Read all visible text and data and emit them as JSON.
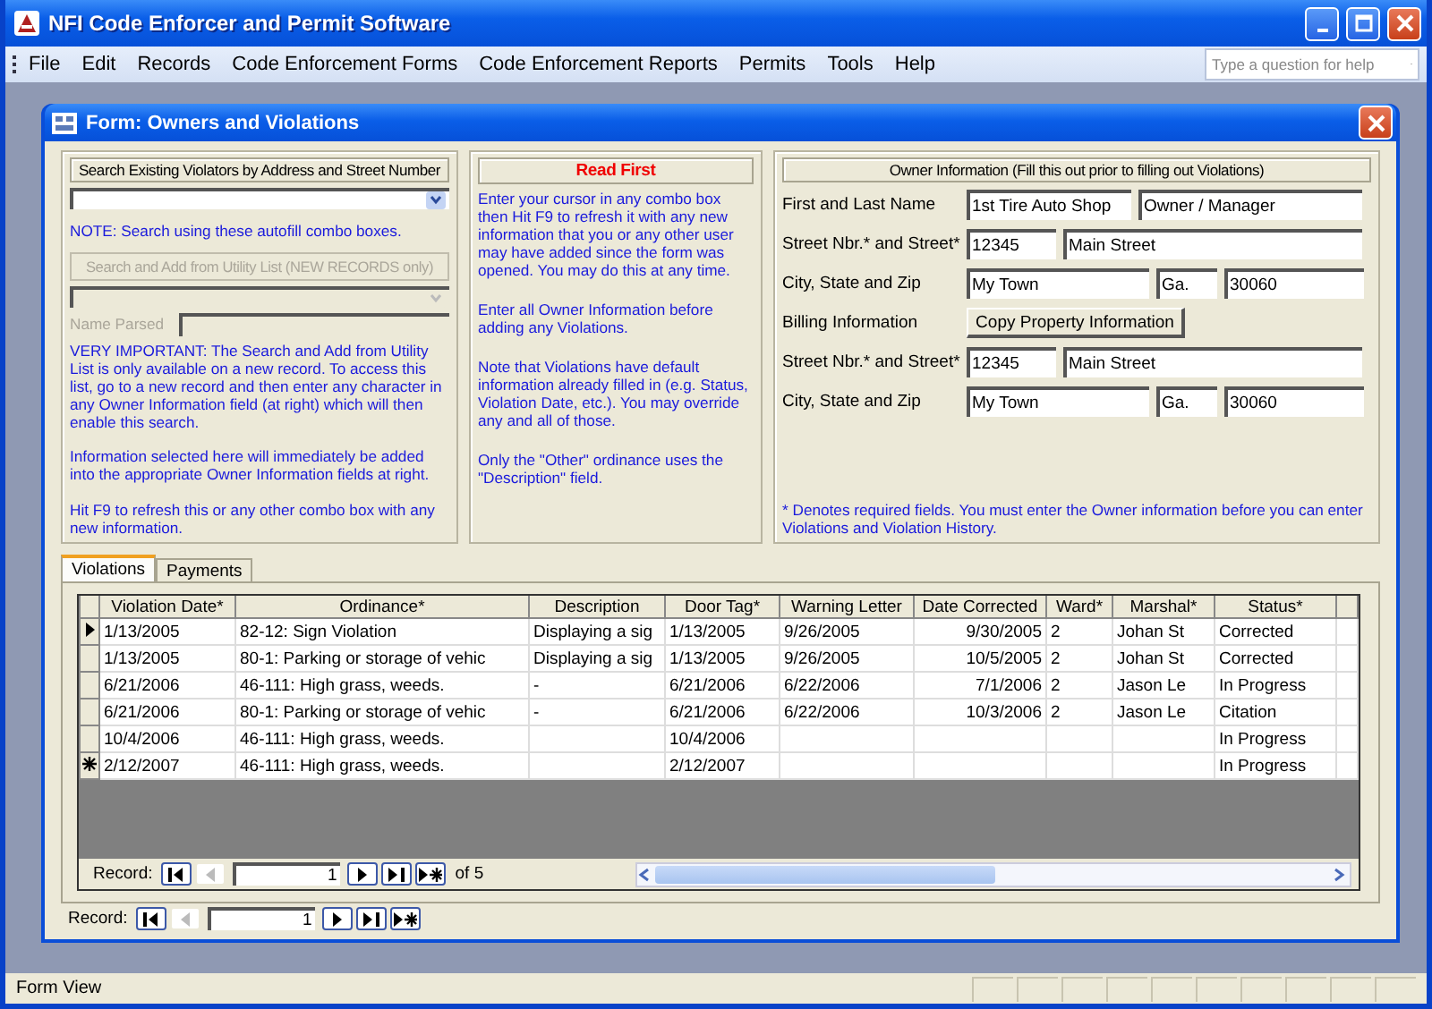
{
  "window": {
    "title": "NFI Code Enforcer and Permit Software"
  },
  "menu": [
    "File",
    "Edit",
    "Records",
    "Code Enforcement Forms",
    "Code Enforcement Reports",
    "Permits",
    "Tools",
    "Help"
  ],
  "help_box": {
    "placeholder": "Type a question for help"
  },
  "form": {
    "title": "Form: Owners and Violations"
  },
  "search_panel": {
    "header": "Search Existing Violators by Address and Street Number",
    "note": "NOTE: Search using these autofill combo boxes.",
    "utility_button": {
      "label": "Search and Add from Utility List (NEW RECORDS only)",
      "disabled": true
    },
    "name_parsed_label": "Name Parsed",
    "paragraphs": [
      "VERY IMPORTANT: The Search and Add from Utility List is only available on a new record.  To access this list, go to a new record and then enter any character in any Owner Information field (at right) which will then enable this search.",
      "Information selected here will immediately be added into the appropriate Owner Information fields at right.",
      "Hit F9 to refresh this or any other combo box with any new information."
    ]
  },
  "read_first": {
    "title": "Read First",
    "paragraphs": [
      "Enter your cursor in any combo box then Hit F9 to refresh it with any new information that you or any other user may have added since the form was opened.  You may do this at any time.",
      "Enter all Owner Information before adding any Violations.",
      "Note that Violations have default information already filled in (e.g. Status, Violation Date, etc.).  You may override any and all of those.",
      "Only the \"Other\" ordinance uses the \"Description\" field."
    ]
  },
  "owner": {
    "header": "Owner Information (Fill this out prior to filling out Violations)",
    "rows": [
      {
        "kind": "fields",
        "label": "First and Last Name",
        "fields": [
          "1st Tire Auto Shop",
          "Owner / Manager"
        ]
      },
      {
        "kind": "fields",
        "label": "Street Nbr.* and Street*",
        "fields": [
          "12345",
          "Main Street"
        ]
      },
      {
        "kind": "fields",
        "label": "City, State and Zip",
        "fields": [
          "My Town",
          "Ga.",
          "30060"
        ]
      },
      {
        "kind": "button",
        "label": "Billing Information",
        "button": "Copy Property Information"
      },
      {
        "kind": "fields",
        "label": "Street Nbr.* and Street*",
        "fields": [
          "12345",
          "Main Street"
        ]
      },
      {
        "kind": "fields",
        "label": "City, State and Zip",
        "fields": [
          "My Town",
          "Ga.",
          "30060"
        ]
      }
    ],
    "footnote": "* Denotes required fields.  You must enter the Owner information before you can enter Violations and Violation History."
  },
  "tabs": [
    {
      "label": "Violations",
      "selected": true
    },
    {
      "label": "Payments",
      "selected": false
    }
  ],
  "table": {
    "columns": [
      "Violation Date*",
      "Ordinance*",
      "Description",
      "Door Tag*",
      "Warning Letter",
      "Date Corrected",
      "Ward*",
      "Marshal*",
      "Status*"
    ],
    "rows": [
      {
        "current": true,
        "new": false,
        "cells": [
          "1/13/2005",
          "82-12: Sign Violation",
          "Displaying a sig",
          "1/13/2005",
          "9/26/2005",
          "9/30/2005",
          "2",
          "Johan St",
          "Corrected"
        ]
      },
      {
        "current": false,
        "new": false,
        "cells": [
          "1/13/2005",
          "80-1: Parking or storage of vehic",
          "Displaying a sig",
          "1/13/2005",
          "9/26/2005",
          "10/5/2005",
          "2",
          "Johan St",
          "Corrected"
        ]
      },
      {
        "current": false,
        "new": false,
        "cells": [
          "6/21/2006",
          "46-111: High grass, weeds.",
          "-",
          "6/21/2006",
          "6/22/2006",
          "7/1/2006",
          "2",
          "Jason Le",
          "In Progress"
        ]
      },
      {
        "current": false,
        "new": false,
        "cells": [
          "6/21/2006",
          "80-1: Parking or storage of vehic",
          "-",
          "6/21/2006",
          "6/22/2006",
          "10/3/2006",
          "2",
          "Jason Le",
          "Citation"
        ]
      },
      {
        "current": false,
        "new": false,
        "cells": [
          "10/4/2006",
          "46-111: High grass, weeds.",
          "",
          "10/4/2006",
          "",
          "",
          "",
          "",
          "In Progress"
        ]
      },
      {
        "current": false,
        "new": true,
        "cells": [
          "2/12/2007",
          "46-111: High grass, weeds.",
          "",
          "2/12/2007",
          "",
          "",
          "",
          "",
          "In Progress"
        ]
      }
    ]
  },
  "subform_nav": {
    "label": "Record:",
    "current": "1",
    "total": "of 5",
    "buttons": [
      {
        "kind": "first",
        "disabled": false
      },
      {
        "kind": "prev",
        "disabled": true
      },
      {
        "kind": "next",
        "disabled": false
      },
      {
        "kind": "last",
        "disabled": false
      },
      {
        "kind": "new",
        "disabled": false
      }
    ]
  },
  "form_nav": {
    "label": "Record:",
    "current": "1",
    "buttons": [
      {
        "kind": "first",
        "disabled": false
      },
      {
        "kind": "prev",
        "disabled": true
      },
      {
        "kind": "next",
        "disabled": false
      },
      {
        "kind": "last",
        "disabled": false
      },
      {
        "kind": "new",
        "disabled": false
      }
    ]
  },
  "status_bar": {
    "text": "Form View"
  }
}
